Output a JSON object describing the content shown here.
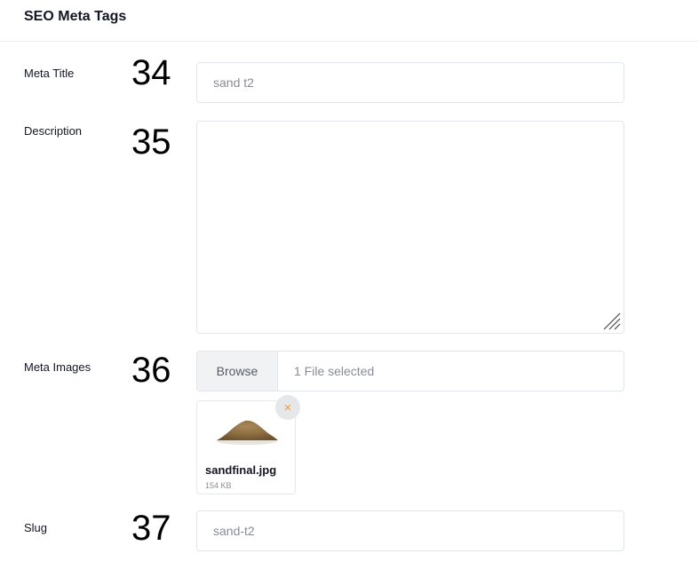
{
  "header": {
    "title": "SEO Meta Tags"
  },
  "fields": {
    "meta_title": {
      "label": "Meta Title",
      "number": "34",
      "value": "sand t2"
    },
    "description": {
      "label": "Description",
      "number": "35",
      "value": ""
    },
    "meta_images": {
      "label": "Meta Images",
      "number": "36",
      "browse_label": "Browse",
      "status": "1 File selected",
      "file": {
        "name": "sandfinal.jpg",
        "size": "154 KB",
        "remove_icon": "×"
      }
    },
    "slug": {
      "label": "Slug",
      "number": "37",
      "value": "sand-t2"
    }
  },
  "colors": {
    "remove_accent": "#f39a34",
    "border": "#e2e5ec",
    "browse_bg": "#f1f2f4"
  }
}
